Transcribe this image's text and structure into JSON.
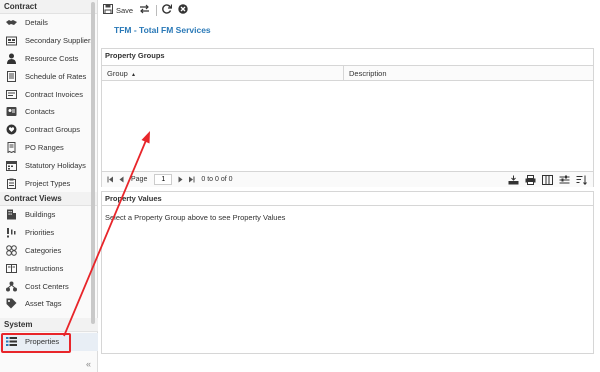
{
  "sidebar": {
    "sections": [
      {
        "title": "Contract",
        "items": [
          {
            "label": "Details",
            "icon": "handshake-icon"
          },
          {
            "label": "Secondary Suppliers",
            "icon": "suppliers-icon"
          },
          {
            "label": "Resource Costs",
            "icon": "person-icon"
          },
          {
            "label": "Schedule of Rates",
            "icon": "document-icon"
          },
          {
            "label": "Contract Invoices",
            "icon": "invoice-icon"
          },
          {
            "label": "Contacts",
            "icon": "contacts-icon"
          },
          {
            "label": "Contract Groups",
            "icon": "heart-icon"
          },
          {
            "label": "PO Ranges",
            "icon": "receipt-icon"
          },
          {
            "label": "Statutory Holidays",
            "icon": "calendar-icon"
          },
          {
            "label": "Project Types",
            "icon": "clipboard-icon"
          }
        ]
      },
      {
        "title": "Contract Views",
        "items": [
          {
            "label": "Buildings",
            "icon": "building-icon"
          },
          {
            "label": "Priorities",
            "icon": "exclamation-icon"
          },
          {
            "label": "Categories",
            "icon": "categories-icon"
          },
          {
            "label": "Instructions",
            "icon": "book-icon"
          },
          {
            "label": "Cost Centers",
            "icon": "cost-centers-icon"
          },
          {
            "label": "Asset Tags",
            "icon": "tag-icon"
          }
        ]
      },
      {
        "title": "System",
        "items": [
          {
            "label": "Properties",
            "icon": "list-icon"
          }
        ]
      }
    ],
    "collapse_glyph": "«"
  },
  "toolbar": {
    "save_label": "Save"
  },
  "page_title": "TFM - Total FM Services",
  "property_groups": {
    "title": "Property Groups",
    "columns": [
      {
        "label": "Group",
        "sort": "asc"
      },
      {
        "label": "Description"
      }
    ],
    "rows": [],
    "pager": {
      "page_label": "Page",
      "page_value": "1",
      "summary": "0 to 0 of 0"
    }
  },
  "property_values": {
    "title": "Property Values",
    "message": "Select a Property Group above to see Property Values"
  },
  "colors": {
    "accent": "#2a79b7",
    "highlight": "#e8252a"
  }
}
